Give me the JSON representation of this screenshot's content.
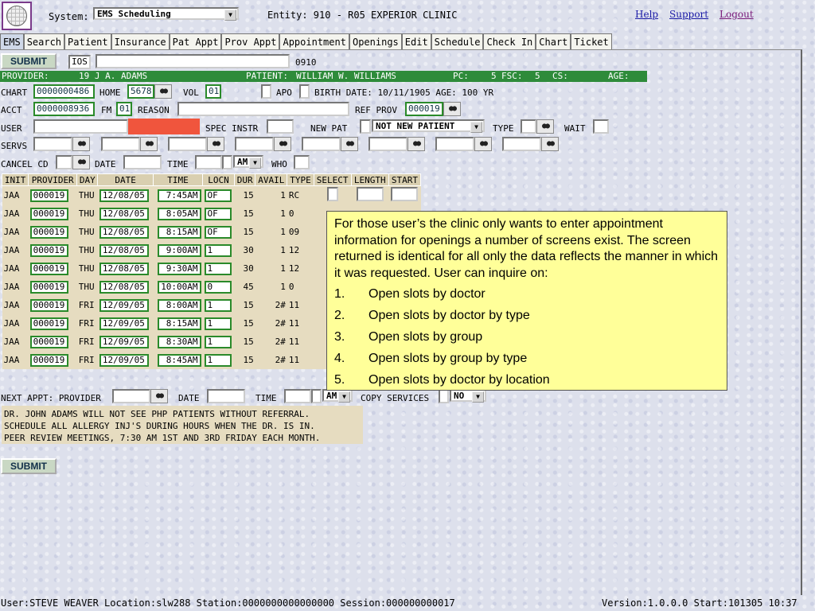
{
  "header": {
    "system_label": "System:",
    "system_value": "EMS Scheduling",
    "entity": "Entity: 910 - R05 EXPERIOR CLINIC",
    "links": [
      "Help",
      "Support",
      "Logout"
    ]
  },
  "tabs": [
    "EMS",
    "Search",
    "Patient",
    "Insurance",
    "Pat Appt",
    "Prov Appt",
    "Appointment",
    "Openings",
    "Edit",
    "Schedule",
    "Check In",
    "Chart",
    "Ticket"
  ],
  "form": {
    "submit_label": "SUBMIT",
    "command_value": "IOS",
    "command2_value": "",
    "code": "0910",
    "banner": {
      "provider_label": "PROVIDER:",
      "provider_value": "19 J A. ADAMS",
      "patient_label": "PATIENT:",
      "patient_value": "WILLIAM W. WILLIAMS",
      "pc": "PC:",
      "pc_value": "5",
      "fsc": "FSC:",
      "fsc_value": "5",
      "cs": "CS:",
      "age": "AGE:"
    },
    "chart_label": "CHART",
    "chart_value": "0000000486",
    "home_label": "HOME",
    "home_value": "5678",
    "vol_label": "VOL",
    "vol_value": "01",
    "apo_label": "APO",
    "birth": "BIRTH DATE: 10/11/1905 AGE: 100 YR",
    "acct_label": "ACCT",
    "acct_value": "0000008936",
    "fm_label": "FM",
    "fm_value": "01",
    "reason_label": "REASON",
    "refprov_label": "REF PROV",
    "refprov_value": "000019",
    "user_label": "USER",
    "specinstr_label": "SPEC INSTR",
    "newpat_label": "NEW PAT",
    "newpat_select": "NOT NEW PATIENT",
    "type_label": "TYPE",
    "wait_label": "WAIT",
    "servs_label": "SERVS",
    "cancel_label": "CANCEL CD",
    "date_label": "DATE",
    "time_label": "TIME",
    "ampm": "AM",
    "who_label": "WHO"
  },
  "grid": {
    "headers": [
      "INIT",
      "PROVIDER",
      "DAY",
      "DATE",
      "TIME",
      "LOCN",
      "DUR",
      "AVAIL",
      "TYPE",
      "SELECT",
      "LENGTH",
      "START"
    ],
    "rows": [
      [
        "JAA",
        "000019",
        "THU",
        "12/08/05",
        "7:45AM",
        "OF",
        "15",
        "1",
        "RC"
      ],
      [
        "JAA",
        "000019",
        "THU",
        "12/08/05",
        "8:05AM",
        "OF",
        "15",
        "1",
        "0"
      ],
      [
        "JAA",
        "000019",
        "THU",
        "12/08/05",
        "8:15AM",
        "OF",
        "15",
        "1",
        "09"
      ],
      [
        "JAA",
        "000019",
        "THU",
        "12/08/05",
        "9:00AM",
        "1",
        "30",
        "1",
        "12"
      ],
      [
        "JAA",
        "000019",
        "THU",
        "12/08/05",
        "9:30AM",
        "1",
        "30",
        "1",
        "12"
      ],
      [
        "JAA",
        "000019",
        "THU",
        "12/08/05",
        "10:00AM",
        "0",
        "45",
        "1",
        "0"
      ],
      [
        "JAA",
        "000019",
        "FRI",
        "12/09/05",
        "8:00AM",
        "1",
        "15",
        "2#",
        "11"
      ],
      [
        "JAA",
        "000019",
        "FRI",
        "12/09/05",
        "8:15AM",
        "1",
        "15",
        "2#",
        "11"
      ],
      [
        "JAA",
        "000019",
        "FRI",
        "12/09/05",
        "8:30AM",
        "1",
        "15",
        "2#",
        "11"
      ],
      [
        "JAA",
        "000019",
        "FRI",
        "12/09/05",
        "8:45AM",
        "1",
        "15",
        "2#",
        "11"
      ]
    ]
  },
  "next_appt": {
    "label": "NEXT APPT: PROVIDER",
    "date_label": "DATE",
    "time_label": "TIME",
    "ampm": "AM",
    "copy_label": "COPY SERVICES",
    "copy_value": "NO"
  },
  "notes": [
    "DR. JOHN ADAMS WILL NOT SEE PHP PATIENTS WITHOUT REFERRAL.",
    "SCHEDULE ALL ALLERGY INJ'S DURING HOURS WHEN THE DR. IS IN.",
    "PEER REVIEW MEETINGS, 7:30 AM 1ST AND 3RD FRIDAY EACH MONTH."
  ],
  "callout": {
    "intro": "For those user’s the clinic only wants to enter appointment information for openings a number of screens exist.  The screen returned is identical for all only the data reflects the manner in which it was requested.  User can inquire on:",
    "items": [
      {
        "n": "1.",
        "text": "Open slots by doctor"
      },
      {
        "n": "2.",
        "text": "Open slots by doctor by type"
      },
      {
        "n": "3.",
        "text": "Open slots by group"
      },
      {
        "n": "4.",
        "text": "Open slots by group by type"
      },
      {
        "n": "5.",
        "text": "Open slots by doctor by location"
      }
    ]
  },
  "status": {
    "left": "User:STEVE WEAVER Location:slw288 Station:0000000000000000 Session:000000000017",
    "right": "Version:1.0.0.0  Start:101305 10:37"
  }
}
